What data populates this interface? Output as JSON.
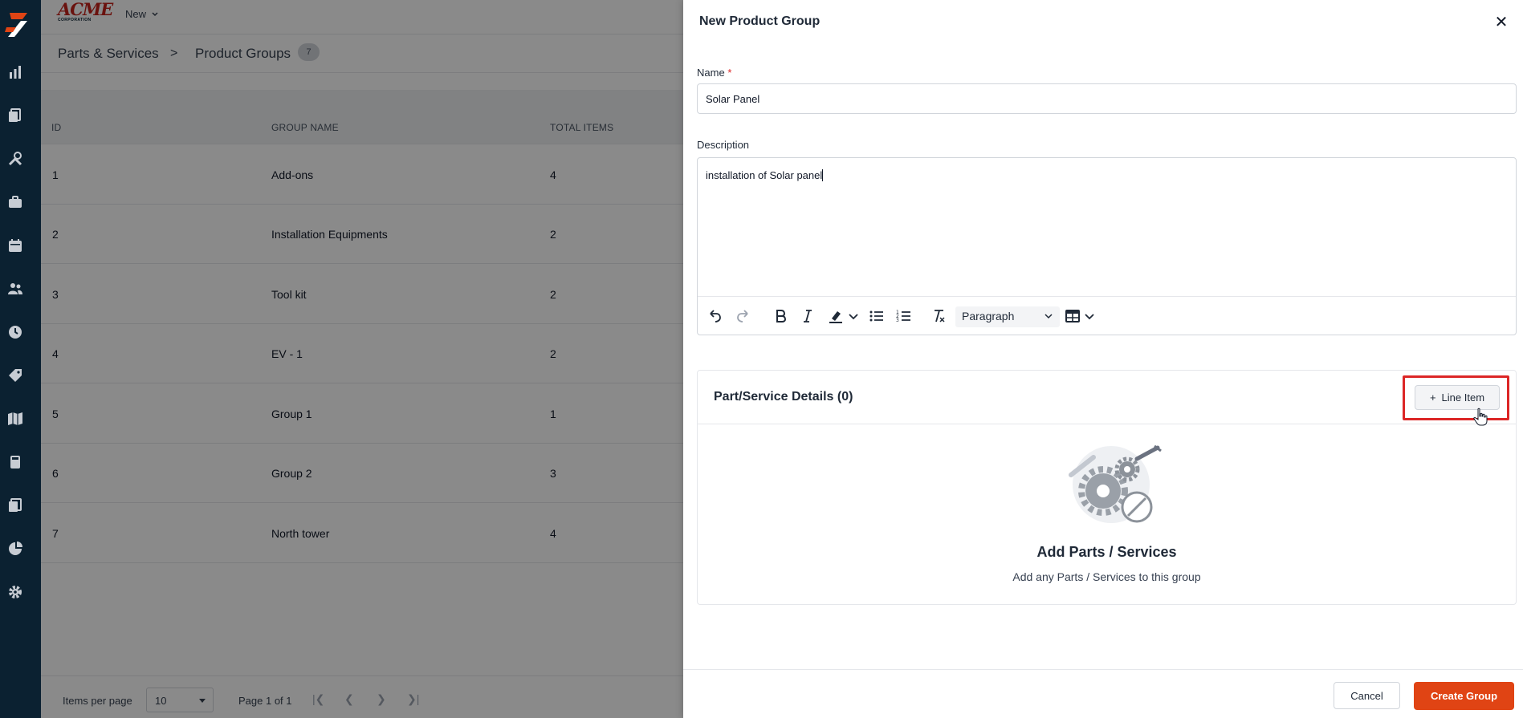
{
  "app": {
    "brand_word": "ACME",
    "brand_sub": "CORPORATION",
    "new_menu_label": "New"
  },
  "rail": {
    "icons": [
      "logo-icon",
      "dashboard-icon",
      "documents-icon",
      "tools-icon",
      "briefcase-icon",
      "calendar-icon",
      "users-icon",
      "clock-icon",
      "tag-icon",
      "map-icon",
      "calculator-icon",
      "reports-icon",
      "pie-chart-icon",
      "settings-icon"
    ]
  },
  "breadcrumb": {
    "parent": "Parts & Services",
    "separator": ">",
    "current": "Product Groups",
    "count": "7"
  },
  "table": {
    "headers": {
      "id": "ID",
      "name": "GROUP NAME",
      "total": "TOTAL ITEMS"
    },
    "rows": [
      {
        "id": "1",
        "name": "Add-ons",
        "total": "4"
      },
      {
        "id": "2",
        "name": "Installation Equipments",
        "total": "2"
      },
      {
        "id": "3",
        "name": "Tool kit",
        "total": "2"
      },
      {
        "id": "4",
        "name": "EV - 1",
        "total": "2"
      },
      {
        "id": "5",
        "name": "Group 1",
        "total": "1"
      },
      {
        "id": "6",
        "name": "Group 2",
        "total": "3"
      },
      {
        "id": "7",
        "name": "North tower",
        "total": "4"
      }
    ]
  },
  "pager": {
    "items_per_page_label": "Items per page",
    "items_per_page_value": "10",
    "page_info": "Page 1 of 1"
  },
  "drawer": {
    "title": "New Product Group",
    "close_glyph": "✕",
    "name_label": "Name",
    "required_mark": "*",
    "name_value": "Solar Panel",
    "description_label": "Description",
    "description_value": "installation of Solar panel",
    "block_format": "Paragraph",
    "details_title": "Part/Service Details (0)",
    "line_item_label": "Line Item",
    "line_item_plus": "+",
    "empty_title": "Add Parts / Services",
    "empty_subtitle": "Add any Parts / Services to this group",
    "cancel_label": "Cancel",
    "create_label": "Create Group"
  },
  "colors": {
    "rail_bg": "#0b2131",
    "brand_red": "#c4221b",
    "primary_button": "#e04414",
    "highlight": "#dc2626"
  }
}
